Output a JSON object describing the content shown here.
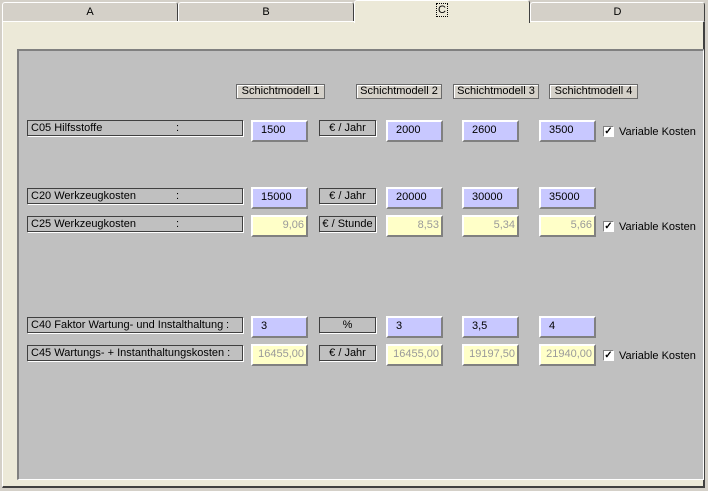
{
  "tabs": [
    {
      "label": "A"
    },
    {
      "label": "B"
    },
    {
      "label": "C"
    },
    {
      "label": "D"
    }
  ],
  "headers": [
    "Schichtmodell 1",
    "Schichtmodell 2",
    "Schichtmodell 3",
    "Schichtmodell 4"
  ],
  "rows": {
    "c05": {
      "label": "C05  Hilfsstoffe",
      "colon": ":",
      "unit": "€ / Jahr",
      "values": [
        "1500",
        "2000",
        "2600",
        "3500"
      ],
      "checkbox_label": "Variable Kosten",
      "checkbox_mark": "✓"
    },
    "c20": {
      "label": "C20  Werkzeugkosten",
      "colon": ":",
      "unit": "€ / Jahr",
      "values": [
        "15000",
        "20000",
        "30000",
        "35000"
      ]
    },
    "c25": {
      "label": "C25  Werkzeugkosten",
      "colon": ":",
      "unit": "€ / Stunde",
      "values": [
        "9,06",
        "8,53",
        "5,34",
        "5,66"
      ],
      "checkbox_label": "Variable Kosten",
      "checkbox_mark": "✓"
    },
    "c40": {
      "label": "C40  Faktor Wartung- und Instalthaltung",
      "colon": ":",
      "unit": "%",
      "values": [
        "3",
        "3",
        "3,5",
        "4"
      ]
    },
    "c45": {
      "label": "C45  Wartungs- + Instanthaltungskosten :",
      "unit": "€ / Jahr",
      "values": [
        "16455,00",
        "16455,00",
        "19197,50",
        "21940,00"
      ],
      "checkbox_label": "Variable Kosten",
      "checkbox_mark": "✓"
    }
  }
}
